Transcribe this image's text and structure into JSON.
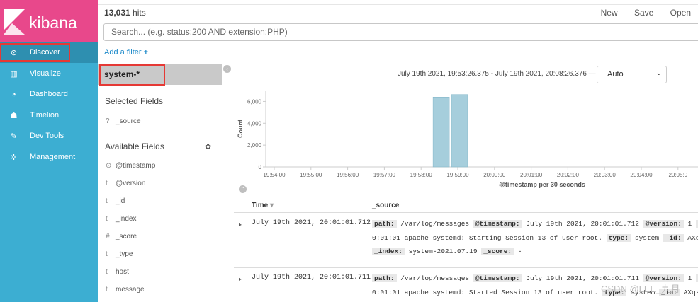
{
  "brand": {
    "name": "kibana",
    "color": "#e8488b"
  },
  "nav": [
    {
      "label": "Discover",
      "icon": "compass-icon"
    },
    {
      "label": "Visualize",
      "icon": "bar-chart-icon"
    },
    {
      "label": "Dashboard",
      "icon": "dashboard-icon"
    },
    {
      "label": "Timelion",
      "icon": "timelion-icon"
    },
    {
      "label": "Dev Tools",
      "icon": "wrench-icon"
    },
    {
      "label": "Management",
      "icon": "gear-icon"
    }
  ],
  "header": {
    "hits_count": "13,031",
    "hits_label": "hits",
    "new": "New",
    "save": "Save",
    "open": "Open"
  },
  "search": {
    "placeholder": "Search... (e.g. status:200 AND extension:PHP)"
  },
  "filter": {
    "add_label": "Add a filter"
  },
  "index_pattern": "system-*",
  "fields": {
    "selected_title": "Selected Fields",
    "selected": [
      {
        "type": "?",
        "name": "_source"
      }
    ],
    "available_title": "Available Fields",
    "available": [
      {
        "type": "⊙",
        "name": "@timestamp"
      },
      {
        "type": "t",
        "name": "@version"
      },
      {
        "type": "t",
        "name": "_id"
      },
      {
        "type": "t",
        "name": "_index"
      },
      {
        "type": "#",
        "name": "_score"
      },
      {
        "type": "t",
        "name": "_type"
      },
      {
        "type": "t",
        "name": "host"
      },
      {
        "type": "t",
        "name": "message"
      }
    ]
  },
  "time_range": "July 19th 2021, 19:53:26.375 - July 19th 2021, 20:08:26.376 —",
  "interval": "Auto",
  "chart_data": {
    "type": "bar",
    "ylabel": "Count",
    "xlabel": "@timestamp per 30 seconds",
    "ylim": [
      0,
      7000
    ],
    "yticks": [
      "0",
      "2,000",
      "4,000",
      "6,000"
    ],
    "xticks": [
      "19:54:00",
      "19:55:00",
      "19:56:00",
      "19:57:00",
      "19:58:00",
      "19:59:00",
      "20:00:00",
      "20:01:00",
      "20:02:00",
      "20:03:00",
      "20:04:00",
      "20:05:0"
    ],
    "bars": [
      {
        "x": "19:58:30",
        "value": 6400
      },
      {
        "x": "19:59:00",
        "value": 6630
      }
    ],
    "color": "#a6cedc"
  },
  "table": {
    "col_time": "Time",
    "col_source": "_source",
    "rows": [
      {
        "time": "July 19th 2021, 20:01:01.712",
        "l1": [
          [
            "path:",
            "/var/log/messages"
          ],
          [
            "@timestamp:",
            "July 19th 2021, 20:01:01.712"
          ],
          [
            "@version:",
            "1"
          ],
          [
            "h",
            ""
          ]
        ],
        "l2": "0:01:01 apache systemd: Starting Session 13 of user root.",
        "l2b": [
          [
            "type:",
            "system"
          ],
          [
            "_id:",
            "AXq-"
          ]
        ],
        "l3": [
          [
            "_index:",
            "system-2021.07.19"
          ],
          [
            "_score:",
            "-"
          ]
        ]
      },
      {
        "time": "July 19th 2021, 20:01:01.711",
        "l1": [
          [
            "path:",
            "/var/log/messages"
          ],
          [
            "@timestamp:",
            "July 19th 2021, 20:01:01.711"
          ],
          [
            "@version:",
            "1"
          ],
          [
            "h",
            ""
          ]
        ],
        "l2": "0:01:01 apache systemd: Started Session 13 of user root.",
        "l2b": [
          [
            "type:",
            "system"
          ],
          [
            "_id:",
            "AXq-p"
          ]
        ]
      }
    ]
  },
  "watermark": "CSDN @LEE_九月"
}
